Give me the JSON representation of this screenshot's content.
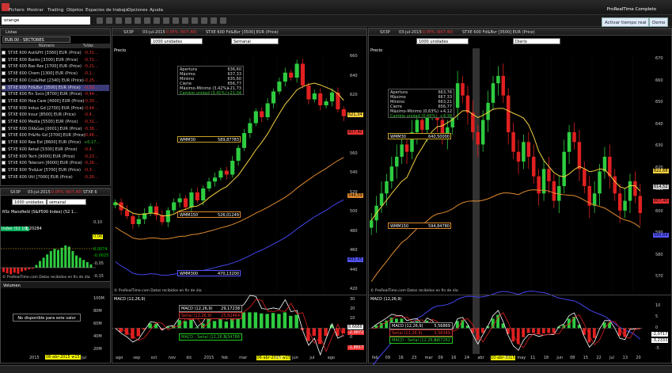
{
  "app": {
    "title": "ProRealTime Completo",
    "menu": [
      "Fichero",
      "Mostrar",
      "Trading",
      "Objetos",
      "Espacios de trabajo",
      "Opciones",
      "Ayuda"
    ],
    "search_value": "orange",
    "realtime_btn": "Activar tiempo real",
    "demo_btn": "Demo"
  },
  "list": {
    "title": "Listas",
    "list_name": "EUR.00 - SECTORES",
    "col_name": "Número",
    "col_var": "%Var.",
    "rows": [
      {
        "name": "STXE 600 Aut&Prt [3360] EUR (Price)",
        "var": "-0,31..."
      },
      {
        "name": "STXE 600 Banks [3300] EUR (Price)",
        "var": "-0,71..."
      },
      {
        "name": "STXE 600 Bas Res [1700] EUR (Price)",
        "var": "-0,21..."
      },
      {
        "name": "STXE 600 Chem [1300] EUR (Price)",
        "var": "-0,1..."
      },
      {
        "name": "STXE 600 Cns&Mat [2340] EUR (Price)",
        "var": "-0,25..."
      },
      {
        "name": "STXE 600 Fd&Bvr [3500] EUR (Price)",
        "var": "-0,50..."
      },
      {
        "name": "STXE 600 Fin Svcs [8700] EUR (Price)",
        "var": "-0,44..."
      },
      {
        "name": "STXE 600 Hea Care [4000] EUR (Price)",
        "var": "-0,30..."
      },
      {
        "name": "STXE 600 Indus Gd [2700] EUR (Price)",
        "var": "-0,44..."
      },
      {
        "name": "STXE 600 Insur [8500] EUR (Price)",
        "var": "-0,4..."
      },
      {
        "name": "STXE 600 Media [5500] EUR (Price)",
        "var": "-0,31..."
      },
      {
        "name": "STXE 600 Oil&Gas [0001] EUR (Price)",
        "var": "-0,36..."
      },
      {
        "name": "STXE 600 Pr&Ho Gd [3700] EUR (Price)",
        "var": "-0,46..."
      },
      {
        "name": "STXE 600 Rea Est [8600] EUR (Price)",
        "var": "+0,17..."
      },
      {
        "name": "STXE 600 Retail [5300] EUR (Price)",
        "var": "-0,4..."
      },
      {
        "name": "STXE 600 Tech [9000] EUR (Price)",
        "var": "-0,23..."
      },
      {
        "name": "STXE 600 Telecom [6000] EUR (Price)",
        "var": "-0,26..."
      },
      {
        "name": "STXE 600 Trv&Lsr [5700] EUR (Price)",
        "var": "-0,3..."
      },
      {
        "name": "STXE 600 Util [7000] EUR (Price)",
        "var": "-0,26..."
      }
    ]
  },
  "small": {
    "code": "SX3P",
    "date": "03-jul-2015",
    "change": "-0,05% (607,40)",
    "name": "STXE 6",
    "units": "1000 unidades",
    "period": "semanal",
    "indicator": "RSc Mansfield (S&P500 Index) (52 1...",
    "ind_tag": "Index (52 10)",
    "ind_val": "1,20284",
    "lvl_top": "0,06",
    "lvl_mid": "0,0074",
    "lvl_bot": "-0,0025",
    "footer": "© ProRealTime.com  Datos recibidos en fin de dia",
    "vol_title": "Volumen",
    "vol_msg": "No disponible para este valor",
    "vol_axis": [
      "100M",
      "80M",
      "60M",
      "40M",
      "20M"
    ],
    "x_axis": [
      "2015",
      "06-abr-2015 w15",
      "jul"
    ],
    "axis": [
      "0,10",
      "0,05",
      "0",
      "-0,05",
      "-0,10",
      "-0,15",
      "-0,20"
    ]
  },
  "left_chart": {
    "code": "SX3P",
    "date": "03-jul-2015",
    "change": "-0,05% (607,40)",
    "name": "STXE 600 Fd&Bvr [3500] EUR (Price)",
    "units": "1000 unidades",
    "period": "Semanal",
    "price_tab": "Precio",
    "info": [
      [
        "Apertura",
        "636,60"
      ],
      [
        "Máximo",
        "637,33"
      ],
      [
        "Mínimo",
        "635,60"
      ],
      [
        "Cierre",
        "656,77"
      ],
      [
        "Máximo-Mínimo (3,42%)",
        "+21,73"
      ],
      [
        "Cambio unidad (3,41%)",
        "+21,04"
      ]
    ],
    "wmm30": {
      "label": "WMM30",
      "value": "589,87783"
    },
    "wmm150": {
      "label": "WMM150",
      "value": "526,01249"
    },
    "wmm300": {
      "label": "WMM300",
      "value": "470,13200"
    },
    "y_axis": [
      "660",
      "640",
      "620",
      "600",
      "580",
      "560",
      "540",
      "520",
      "500",
      "480",
      "460",
      "440",
      "420"
    ],
    "tags": [
      {
        "text": "621,34",
        "color": "#f4d03f"
      },
      {
        "text": "607,40",
        "color": "#e33"
      },
      {
        "text": "544,59",
        "color": "#e08a2e"
      },
      {
        "text": "493,45",
        "color": "#5555ff"
      }
    ],
    "footer": "© ProRealTime.com  Datos recibidos en fin de dia",
    "macd": {
      "title": "MACD (12,26,9)",
      "l1": "MACD (12,26,9)",
      "v1": "29,17238",
      "l2": "Señal (12,26,9)",
      "v2": "25,82464",
      "l3": "MACD - Señal (12,26,9)",
      "v3": "3,34788",
      "axis": [
        "30",
        "20",
        "10",
        "0",
        "-10"
      ],
      "tags": [
        "8,6688",
        "-2,9872",
        "-1,8817"
      ]
    },
    "x_axis": [
      "ago",
      "sep",
      "oct",
      "nov",
      "dic",
      "2015",
      "feb",
      "mar",
      "06-abr-2015 w15",
      "may",
      "jun",
      "jul",
      "ago"
    ],
    "chart_data": {
      "type": "candlestick",
      "weekly_close": [
        520,
        512,
        506,
        498,
        503,
        509,
        516,
        507,
        500,
        512,
        520,
        524,
        515,
        530,
        522,
        534,
        541,
        545,
        552,
        548,
        562,
        575,
        590,
        600,
        612,
        606,
        620,
        632,
        642,
        651,
        646,
        660,
        638,
        624,
        630,
        618,
        622,
        631,
        614,
        607
      ]
    }
  },
  "right_chart": {
    "code": "SX3P",
    "date": "03-jul-2015",
    "change": "-0,05% (607,40)",
    "name": "STXE 600 Fd&Bvr [3500] EUR (Price)",
    "units": "1000 unidades",
    "period": "Diario",
    "price_tab": "Precio",
    "info": [
      [
        "Apertura",
        "663,76"
      ],
      [
        "Máximo",
        "667,33"
      ],
      [
        "Mínimo",
        "663,21"
      ],
      [
        "Cierre",
        "656,77"
      ],
      [
        "Máximo-Mínimo (0,63%)",
        "+4,12"
      ],
      [
        "Cambio unidad (0,66%)",
        "+4,38"
      ]
    ],
    "wmm30": {
      "label": "WMM30",
      "value": "640,50000"
    },
    "wmm150": {
      "label": "WMM150",
      "value": "594,84780"
    },
    "y_axis": [
      "670",
      "660",
      "650",
      "640",
      "630",
      "620",
      "610",
      "600",
      "590",
      "580",
      "570"
    ],
    "tags": [
      {
        "text": "622,68",
        "color": "#f4d03f"
      },
      {
        "text": "614,52",
        "color": "#ccc"
      },
      {
        "text": "607,40",
        "color": "#e33"
      },
      {
        "text": "595,64",
        "color": "#5555ff"
      }
    ],
    "footer": "© ProRealTime.com  Datos recibidos en fin de dia",
    "macd": {
      "title": "MACD (12,26,9)",
      "l1": "MACD (12,26,9)",
      "v1": "5,56869",
      "l2": "Señal (12,26,9)",
      "v2": "3,56349",
      "l3": "MACD - Señal (12,26,9)",
      "v3": "0,67262",
      "axis": [
        "10",
        "5",
        "0",
        "-5"
      ],
      "tags": [
        "-2,0717",
        "-3,2333"
      ]
    },
    "x_axis": [
      "feb",
      "09",
      "16",
      "23",
      "mar",
      "09",
      "16",
      "24",
      "abr",
      "10-abr-2015",
      "27",
      "may",
      "11",
      "18",
      "jun",
      "08",
      "15",
      "22",
      "jul",
      "13",
      "20"
    ],
    "chart_data": {
      "type": "candlestick",
      "daily_close": [
        604,
        610,
        615,
        620,
        626,
        630,
        635,
        632,
        640,
        645,
        641,
        648,
        652,
        645,
        638,
        642,
        650,
        660,
        655,
        648,
        640,
        635,
        645,
        652,
        660,
        663,
        655,
        640,
        632,
        628,
        636,
        630,
        622,
        615,
        625,
        620,
        612,
        618,
        632,
        640,
        636,
        625,
        618,
        610,
        615,
        624,
        630,
        622,
        615,
        608,
        612,
        620,
        614,
        607
      ]
    }
  }
}
